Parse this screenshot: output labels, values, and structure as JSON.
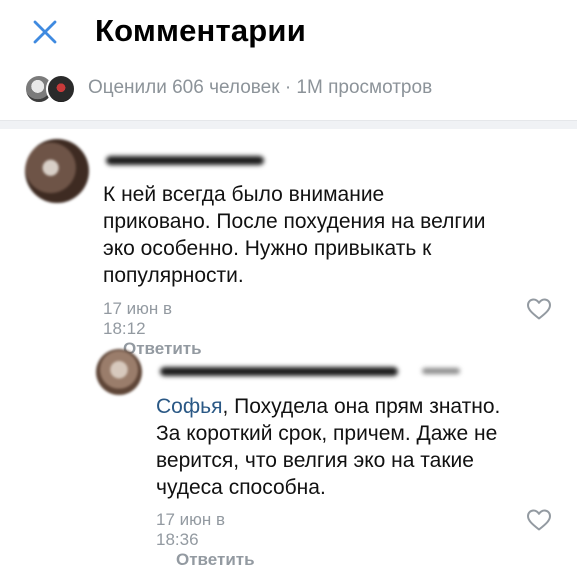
{
  "header": {
    "title": "Комментарии",
    "close_icon": "close-icon"
  },
  "stats": {
    "text": "Оценили 606 человек · 1М просмотров"
  },
  "comments": [
    {
      "text": "К ней всегда было внимание\nприковано. После похудения на велгии\nэко особенно. Нужно привыкать к\nпопулярности.",
      "date": "17 июн в 18:12",
      "reply_label": "Ответить"
    },
    {
      "mention": "Софья",
      "text": ", Похудела она прям знатно.\nЗа короткий срок, причем. Даже не\nверится, что велгия эко на такие\nчудеса способна.",
      "date": "17 июн в 18:36",
      "reply_label": "Ответить"
    }
  ],
  "colors": {
    "accent": "#3f8ae0",
    "link": "#2a5885",
    "secondary_text": "#939aa1"
  }
}
